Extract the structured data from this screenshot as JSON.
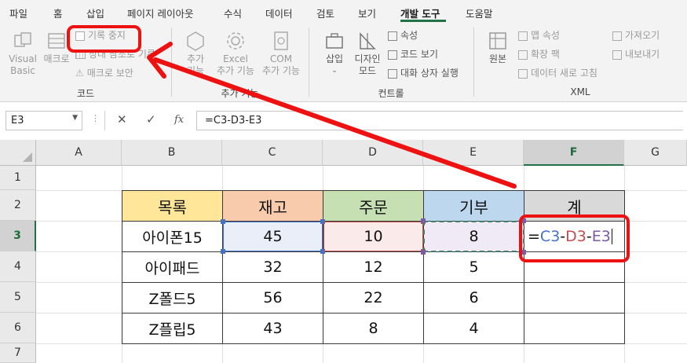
{
  "menu": {
    "tabs": [
      "파일",
      "홈",
      "삽입",
      "페이지 레이아웃",
      "수식",
      "데이터",
      "검토",
      "보기",
      "개발 도구",
      "도움말"
    ],
    "active_index": 8
  },
  "ribbon": {
    "code_group": {
      "visual_basic": "Visual\nBasic",
      "macro": "매크로",
      "record_stop": "기록 중지",
      "relative_ref": "상대 참조로 기록",
      "macro_security": "매크로 보안",
      "label": "코드"
    },
    "addins_group": {
      "addins": "추가\n기능",
      "excel_addins": "Excel\n추가 기능",
      "com_addins": "COM\n추가 기능",
      "label": "추가 기능"
    },
    "controls_group": {
      "insert": "삽입",
      "design_mode": "디자인\n모드",
      "properties": "속성",
      "view_code": "코드 보기",
      "run_dialog": "대화 상자 실행",
      "label": "컨트롤"
    },
    "xml_group": {
      "source": "원본",
      "map_properties": "맵 속성",
      "expansion_packs": "확장 팩",
      "refresh_data": "데이터 새로 고침",
      "import": "가져오기",
      "export": "내보내기",
      "label": "XML"
    }
  },
  "formula_bar": {
    "name_box": "E3",
    "cancel": "✕",
    "enter": "✓",
    "fx": "fx",
    "formula": "=C3-D3-E3"
  },
  "grid": {
    "columns": [
      "A",
      "B",
      "C",
      "D",
      "E",
      "F",
      "G"
    ],
    "rows": [
      "1",
      "2",
      "3",
      "4",
      "5",
      "6",
      "7"
    ],
    "selected_col": "F",
    "selected_row": "3"
  },
  "table": {
    "headers": [
      "목록",
      "재고",
      "주문",
      "기부",
      "계"
    ],
    "rows": [
      [
        "아이폰15",
        "45",
        "10",
        "8"
      ],
      [
        "아이패드",
        "32",
        "12",
        "5"
      ],
      [
        "Z폴드5",
        "56",
        "22",
        "6"
      ],
      [
        "Z플립5",
        "43",
        "8",
        "4"
      ]
    ],
    "formula_cell": {
      "eq": "=",
      "ref1": "C3",
      "minus1": "-",
      "ref2": "D3",
      "minus2": "-",
      "ref3": "E3"
    }
  },
  "colors": {
    "header_b": "#ffe699",
    "header_c": "#f8cbad",
    "header_d": "#c6e0b4",
    "header_e": "#bdd7ee",
    "header_f": "#d9d9d9",
    "ref_c": "#4472c4",
    "ref_d": "#c0504d",
    "ref_e": "#7b5aa6",
    "annotation_red": "#ee1111",
    "accent_green": "#217346"
  }
}
